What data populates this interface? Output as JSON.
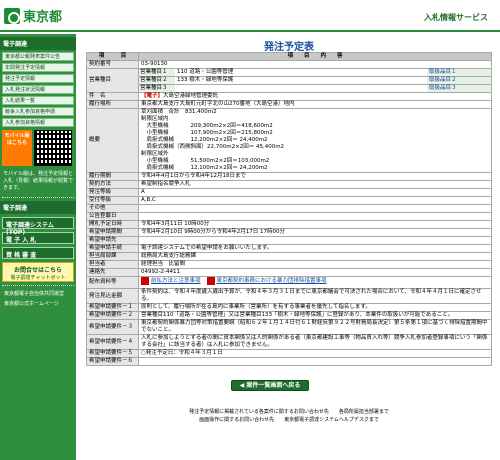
{
  "header": {
    "logo": "東京都",
    "service": "入札情報サービス"
  },
  "sidebar": {
    "section1_title": "電子調達",
    "links": [
      "東京都公報発表案件公告",
      "年間発注予定情報",
      "発注予定情報",
      "入札発注状況情報",
      "入札結果一覧",
      "競争入札参加資格申請",
      "入札参加資格情報"
    ],
    "mobile_label": "モバイル版 はこちら",
    "mobile_note": "モバイル版は、発注予定情報と入札（見積）結果情報が閲覧できます。",
    "section2_title": "電子調達",
    "buttons": [
      "電子調達システム(TOP)",
      "電 子 入 札",
      "資 格 審 査"
    ],
    "pill": "お問合せはこちら",
    "pill_sub": "電子調達チャットボット",
    "bottom_links": [
      "東京都電子自治体共同運営",
      "東京都公式ホームページ"
    ]
  },
  "page": {
    "title": "発注予定表",
    "col_item": "項　　　目",
    "col_content": "項　　目　　内　　容",
    "rows": [
      {
        "label": "契約番号",
        "value": "03-90130"
      },
      {
        "label": "営業種目",
        "subs": [
          {
            "k": "営業種目１",
            "v": "110 道路・公園等管理",
            "btn": "取扱品目１"
          },
          {
            "k": "営業種目２",
            "v": "133 樹木・緑地等保護",
            "btn": "取扱品目２"
          },
          {
            "k": "営業種目３",
            "v": "",
            "btn": "取扱品目３"
          }
        ]
      },
      {
        "label": "件　名",
        "tag": "【電子】",
        "value": "大島空港緑地管理委託"
      },
      {
        "label": "履行場所",
        "value": "東京都大島支庁大島町元町字北の山270番地（大島空港）地内"
      },
      {
        "label": "概要",
        "value": "草刈面積　合計　831,400m2\n制限区域内\n　大型機械　　　　209,300m2×2回＝418,600m2\n　小型機械　　　　107,900m2×2回＝215,800m2\n　肩掛式機械　　　12,200m2×2回＝ 24,400m2\n　肩掛式機械（西側斜面）22,700m2×2回＝ 45,400m2\n制限区域外\n　小型機械　　　　51,500m2×2回＝103,000m2\n　肩掛式機械　　　12,100m2×2回＝ 24,200m2"
      },
      {
        "label": "履行期間",
        "value": "令和4年4月1日から令和4年12月18日まで"
      },
      {
        "label": "契約方法",
        "value": "希望制指名競争入札"
      },
      {
        "label": "発注等級",
        "value": "A"
      },
      {
        "label": "受付等級",
        "value": "A,B,C"
      },
      {
        "label": "その他",
        "value": ""
      },
      {
        "label": "公告登載日",
        "value": ""
      },
      {
        "label": "開札予定日時",
        "value": "令和4年3月11日 10時00分"
      },
      {
        "label": "希望申請期間",
        "value": "令和4年2月10日 9時00分から令和4年2月17日 17時00分"
      },
      {
        "label": "希望申請先",
        "value": ""
      },
      {
        "label": "希望申請手続",
        "value": "電子調達システムでの希望申請をお願いいたします。"
      },
      {
        "label": "担当局部課",
        "value": "総務局大島支庁総務課"
      },
      {
        "label": "担当者",
        "value": "経理担当　比留間"
      },
      {
        "label": "連絡先",
        "value": "04992-2-4411"
      },
      {
        "label": "配布資料等",
        "attachments": [
          "前払方法と注意事項",
          "東京都契約事務における暴力団排除措置事項"
        ]
      },
      {
        "label": "発注見込金額",
        "value": "条件契約は、令和４年度歳入歳出予算が、令和４年３月３１日までに東京都議会で可決された場合において、令和４年４月１日に確定させる。"
      },
      {
        "label": "希望申請要件－１",
        "value": "原則として、履行場所が在る島内に事業所（営業所）を有する事業者を優先して指名します。"
      },
      {
        "label": "希望申請要件－２",
        "value": "営業種目110「道路・公園等管理」又は営業種目133「樹木・緑地等保護」に登録があり、本業件の取扱いが可能であること。"
      },
      {
        "label": "希望申請要件－３",
        "value": "東京都契約関係暴力団等対策措置要綱（昭和６２年１月１４日付６１財経庶第９２２号財務局長決定）第５条第１項に基づく排除措置期間中でないこと。"
      },
      {
        "label": "希望申請要件－４",
        "value": "入札に参加しようとする者の間に資本関係又は人的関係がある者（東京都建設工事等（物品買入れ等）競争入札参加者登録事項にいう「関係する会社」に該当する者）は入札に参加できません。"
      },
      {
        "label": "希望申請要件－５",
        "value": "○発注予定日：令和４年３月１日"
      },
      {
        "label": "希望申請要件－６",
        "value": ""
      }
    ],
    "back_button": "案件一覧画面へ戻る"
  },
  "footer": {
    "line1": "発注予定情報に掲載されている各案件に関するお問い合わせ先　　各局所属担当部署まで",
    "line2": "画面操作に関するお問い合わせ先　　東京都電子調達システムヘルプデスクまで"
  }
}
